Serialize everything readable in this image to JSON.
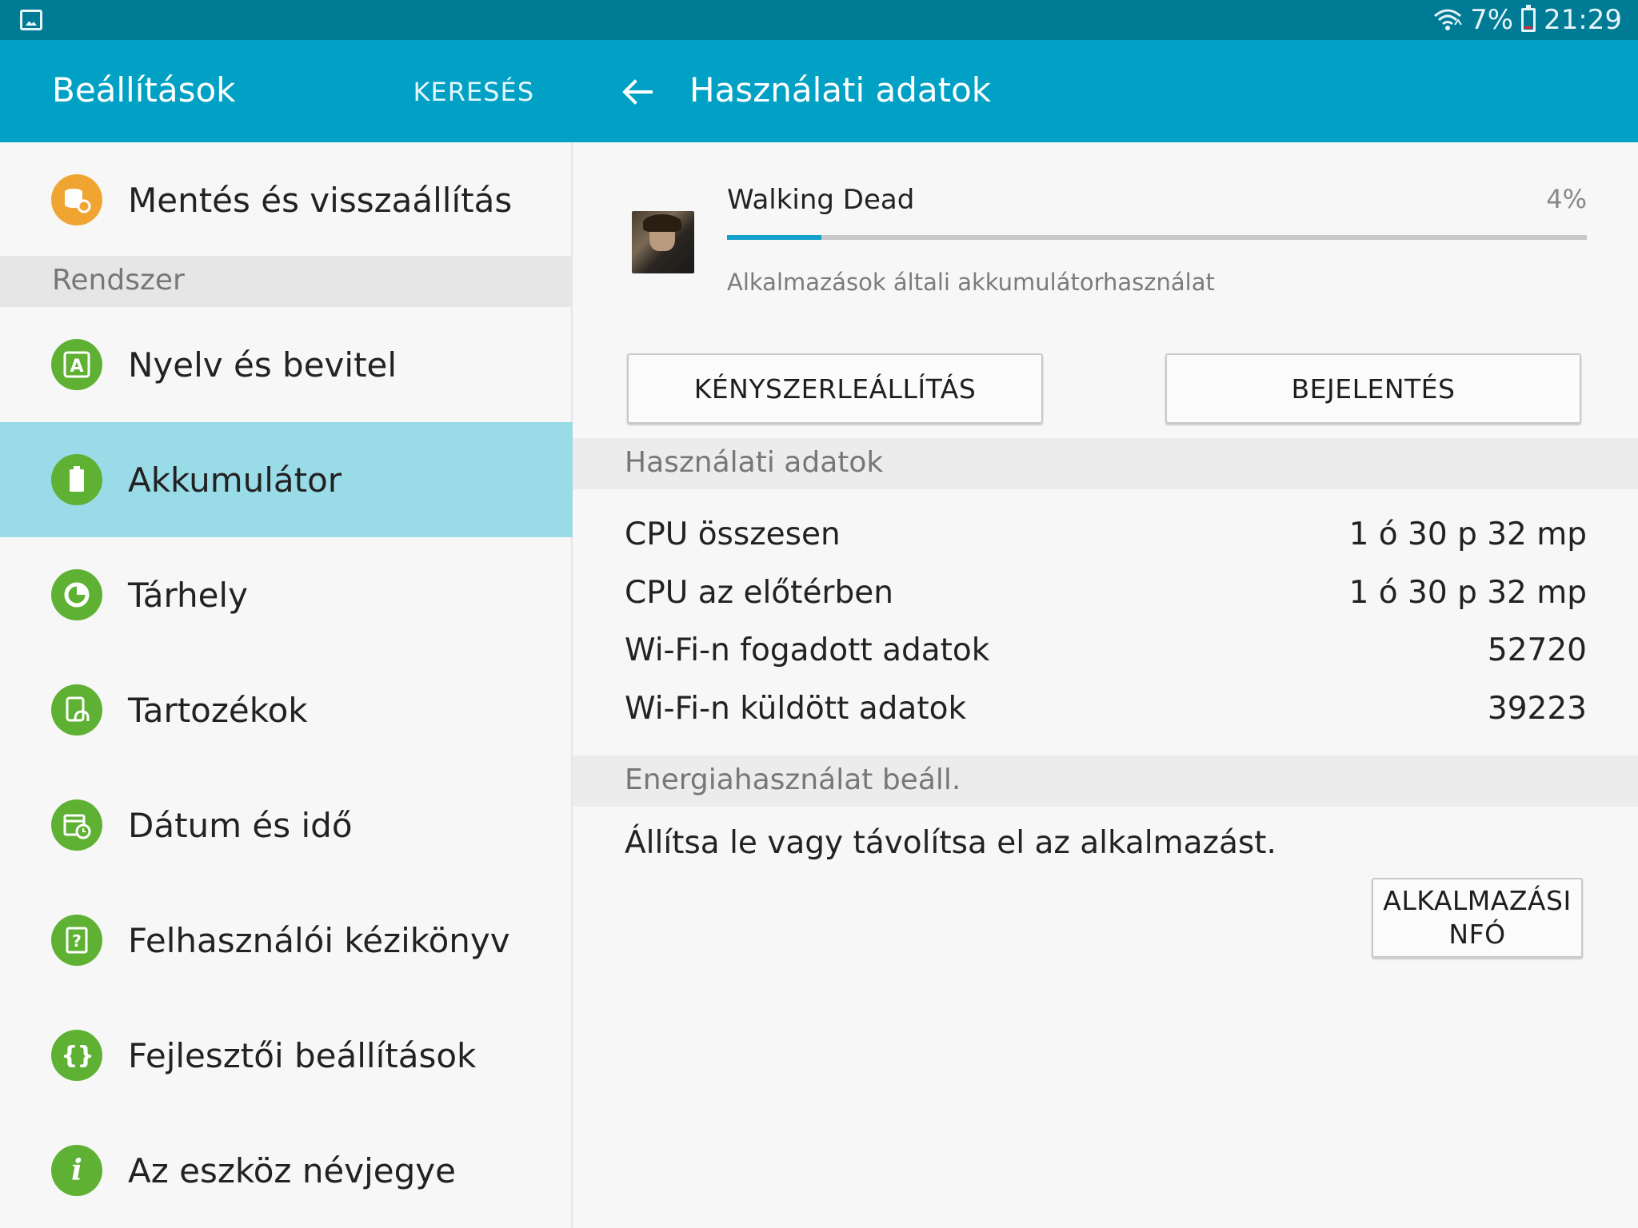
{
  "status_bar": {
    "battery": "7%",
    "time": "21:29",
    "icons": [
      "gallery-icon",
      "wifi-icon",
      "battery-icon"
    ]
  },
  "left_header": {
    "title": "Beállítások",
    "search": "KERESÉS"
  },
  "right_header": {
    "title": "Használati adatok",
    "back_icon": "back-arrow-icon"
  },
  "menu": {
    "top_item": {
      "label": "Mentés és visszaállítás",
      "icon": "backup-icon"
    },
    "section": "Rendszer",
    "items": [
      {
        "label": "Nyelv és bevitel",
        "icon": "language-icon"
      },
      {
        "label": "Akkumulátor",
        "icon": "battery-icon",
        "active": true
      },
      {
        "label": "Tárhely",
        "icon": "storage-icon"
      },
      {
        "label": "Tartozékok",
        "icon": "accessories-icon"
      },
      {
        "label": "Dátum és idő",
        "icon": "calendar-icon"
      },
      {
        "label": "Felhasználói kézikönyv",
        "icon": "manual-icon"
      },
      {
        "label": "Fejlesztői beállítások",
        "icon": "developer-icon"
      },
      {
        "label": "Az eszköz névjegye",
        "icon": "info-icon"
      }
    ]
  },
  "app": {
    "name": "Walking Dead",
    "percent": "4%",
    "usage_fraction": 0.11,
    "subtitle": "Alkalmazások általi akkumulátorhasználat"
  },
  "buttons": {
    "force_stop": "KÉNYSZERLEÁLLÍTÁS",
    "report": "BEJELENTÉS",
    "app_info_line1": "ALKALMAZÁSI",
    "app_info_line2": "NFÓ"
  },
  "usage_section": {
    "title": "Használati adatok",
    "rows": [
      {
        "label": "CPU összesen",
        "value": "1 ó 30 p 32 mp"
      },
      {
        "label": "CPU az előtérben",
        "value": "1 ó 30 p 32 mp"
      },
      {
        "label": "Wi-Fi-n fogadott adatok",
        "value": "52720"
      },
      {
        "label": "Wi-Fi-n küldött adatok",
        "value": "39223"
      }
    ]
  },
  "energy_section": {
    "title": "Energiahasználat beáll.",
    "description": "Állítsa le vagy távolítsa el az alkalmazást."
  },
  "colors": {
    "header": "#00a1c4",
    "status_bar": "#007b96",
    "active_item": "#9adbe8",
    "icon_green": "#5eb133",
    "icon_orange": "#f0a532"
  }
}
